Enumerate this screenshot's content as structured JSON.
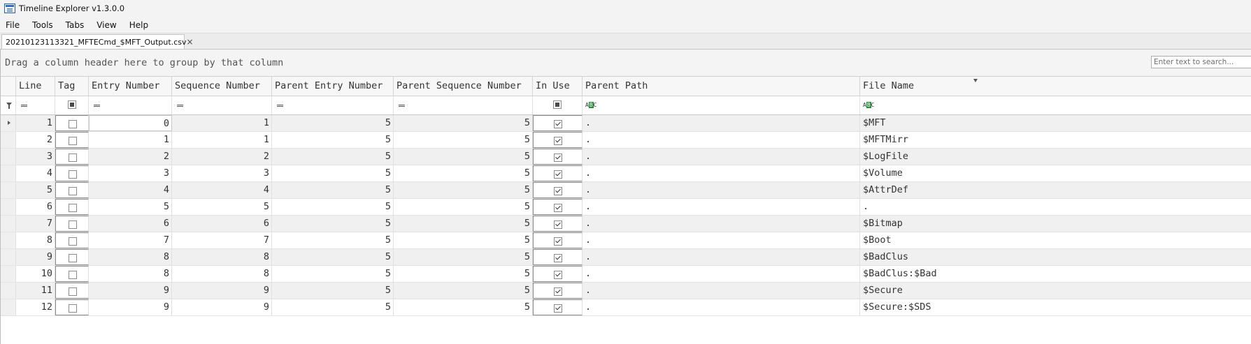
{
  "window": {
    "title": "Timeline Explorer v1.3.0.0",
    "app_icon": "timeline-explorer-icon"
  },
  "menu": [
    "File",
    "Tools",
    "Tabs",
    "View",
    "Help"
  ],
  "tabs": [
    {
      "label": "20210123113321_MFTECmd_$MFT_Output.csv",
      "close": "×"
    }
  ],
  "grid": {
    "group_hint": "Drag a column header here to group by that column",
    "search_placeholder": "Enter text to search...",
    "columns": [
      "Line",
      "Tag",
      "Entry Number",
      "Sequence Number",
      "Parent Entry Number",
      "Parent Sequence Number",
      "In Use",
      "Parent Path",
      "File Name"
    ],
    "filter_row": {
      "operator_icon": "equals-icon",
      "text_icon": "abc-icon",
      "abc_text": [
        "A",
        "B",
        "C"
      ]
    },
    "rows": [
      {
        "line": "1",
        "tag": false,
        "entry": "0",
        "seq": "1",
        "pentry": "5",
        "pseq": "5",
        "in_use": true,
        "ppath": ".",
        "fname": "$MFT"
      },
      {
        "line": "2",
        "tag": false,
        "entry": "1",
        "seq": "1",
        "pentry": "5",
        "pseq": "5",
        "in_use": true,
        "ppath": ".",
        "fname": "$MFTMirr"
      },
      {
        "line": "3",
        "tag": false,
        "entry": "2",
        "seq": "2",
        "pentry": "5",
        "pseq": "5",
        "in_use": true,
        "ppath": ".",
        "fname": "$LogFile"
      },
      {
        "line": "4",
        "tag": false,
        "entry": "3",
        "seq": "3",
        "pentry": "5",
        "pseq": "5",
        "in_use": true,
        "ppath": ".",
        "fname": "$Volume"
      },
      {
        "line": "5",
        "tag": false,
        "entry": "4",
        "seq": "4",
        "pentry": "5",
        "pseq": "5",
        "in_use": true,
        "ppath": ".",
        "fname": "$AttrDef"
      },
      {
        "line": "6",
        "tag": false,
        "entry": "5",
        "seq": "5",
        "pentry": "5",
        "pseq": "5",
        "in_use": true,
        "ppath": ".",
        "fname": "."
      },
      {
        "line": "7",
        "tag": false,
        "entry": "6",
        "seq": "6",
        "pentry": "5",
        "pseq": "5",
        "in_use": true,
        "ppath": ".",
        "fname": "$Bitmap"
      },
      {
        "line": "8",
        "tag": false,
        "entry": "7",
        "seq": "7",
        "pentry": "5",
        "pseq": "5",
        "in_use": true,
        "ppath": ".",
        "fname": "$Boot"
      },
      {
        "line": "9",
        "tag": false,
        "entry": "8",
        "seq": "8",
        "pentry": "5",
        "pseq": "5",
        "in_use": true,
        "ppath": ".",
        "fname": "$BadClus"
      },
      {
        "line": "10",
        "tag": false,
        "entry": "8",
        "seq": "8",
        "pentry": "5",
        "pseq": "5",
        "in_use": true,
        "ppath": ".",
        "fname": "$BadClus:$Bad"
      },
      {
        "line": "11",
        "tag": false,
        "entry": "9",
        "seq": "9",
        "pentry": "5",
        "pseq": "5",
        "in_use": true,
        "ppath": ".",
        "fname": "$Secure"
      },
      {
        "line": "12",
        "tag": false,
        "entry": "9",
        "seq": "9",
        "pentry": "5",
        "pseq": "5",
        "in_use": true,
        "ppath": ".",
        "fname": "$Secure:$SDS"
      }
    ]
  }
}
